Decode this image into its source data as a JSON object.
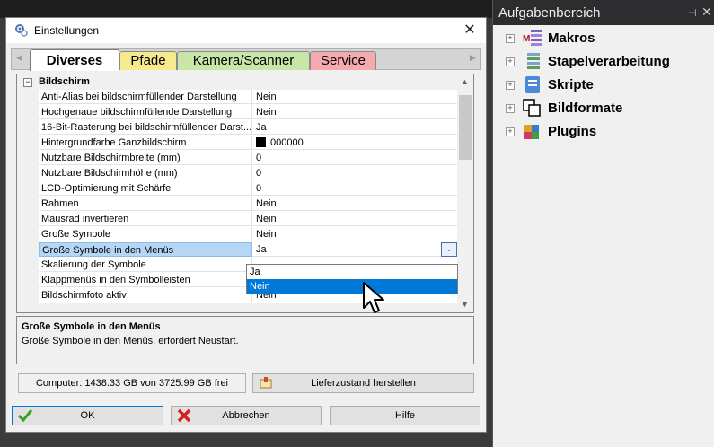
{
  "dialog": {
    "title": "Einstellungen",
    "close_glyph": "✕",
    "tabs": [
      {
        "label": "Diverses",
        "color": "#ffffff"
      },
      {
        "label": "Pfade",
        "color": "#f7e98e"
      },
      {
        "label": "Kamera/Scanner",
        "color": "#c8e6a8"
      },
      {
        "label": "Service",
        "color": "#f5aab0"
      }
    ],
    "tab_left_arrow": "◀",
    "tab_right_arrow": "▶",
    "category": {
      "toggle": "−",
      "label": "Bildschirm"
    },
    "properties": [
      {
        "name": "Anti-Alias bei bildschirmfüllender Darstellung",
        "value": "Nein"
      },
      {
        "name": "Hochgenaue bildschirmfüllende Darstellung",
        "value": "Nein"
      },
      {
        "name": "16-Bit-Rasterung bei bildschirmfüllender Darst...",
        "value": "Ja"
      },
      {
        "name": "Hintergrundfarbe Ganzbildschirm",
        "value": "000000",
        "swatch": "#000000"
      },
      {
        "name": "Nutzbare Bildschirmbreite (mm)",
        "value": "0"
      },
      {
        "name": "Nutzbare Bildschirmhöhe (mm)",
        "value": "0"
      },
      {
        "name": "LCD-Optimierung mit Schärfe",
        "value": "0"
      },
      {
        "name": "Rahmen",
        "value": "Nein"
      },
      {
        "name": "Mausrad invertieren",
        "value": "Nein"
      },
      {
        "name": "Große Symbole",
        "value": "Nein"
      },
      {
        "name": "Große Symbole in den Menüs",
        "value": "Ja"
      },
      {
        "name": "Skalierung der Symbole",
        "value": ""
      },
      {
        "name": "Klappmenüs in den Symbolleisten",
        "value": ""
      },
      {
        "name": "Bildschirmfoto aktiv",
        "value": "Nein"
      }
    ],
    "dropdown_button": "⌄",
    "dropdown_options": [
      "Ja",
      "Nein"
    ],
    "dropdown_highlight": "Nein",
    "scroll_up": "▲",
    "scroll_down": "▼",
    "description": {
      "title": "Große Symbole in den Menüs",
      "text": "Große Symbole in den Menüs, erfordert Neustart."
    },
    "status_text": "Computer: 1438.33 GB von 3725.99 GB frei",
    "reset_label": "Lieferzustand herstellen",
    "ok_label": "OK",
    "cancel_label": "Abbrechen",
    "help_label": "Hilfe"
  },
  "panel": {
    "title": "Aufgabenbereich",
    "pin_glyph": "⊣",
    "close_glyph": "✕",
    "items": [
      {
        "label": "Makros",
        "icon": "macro-icon"
      },
      {
        "label": "Stapelverarbeitung",
        "icon": "batch-icon"
      },
      {
        "label": "Skripte",
        "icon": "script-icon"
      },
      {
        "label": "Bildformate",
        "icon": "image-formats-icon"
      },
      {
        "label": "Plugins",
        "icon": "plugin-icon"
      }
    ],
    "expand_glyph": "+"
  }
}
